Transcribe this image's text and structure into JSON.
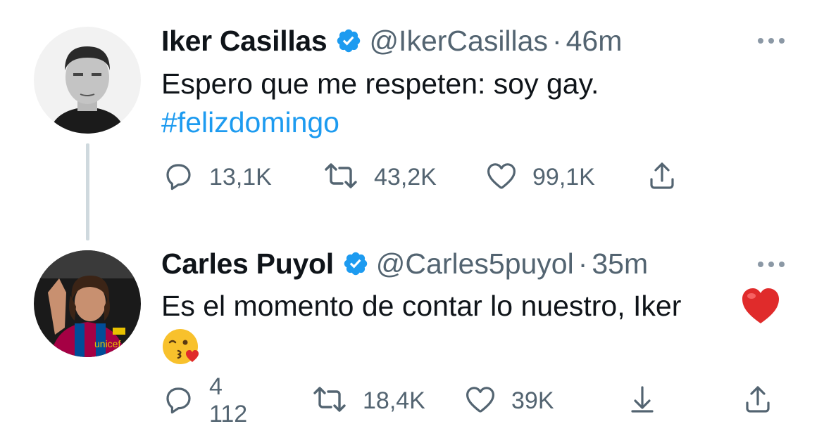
{
  "tweets": [
    {
      "name": "Iker Casillas",
      "handle": "@IkerCasillas",
      "separator": "·",
      "time": "46m",
      "text": "Espero que me respeten: soy gay.",
      "hashtag": "#felizdomingo",
      "replies": "13,1K",
      "retweets": "43,2K",
      "likes": "99,1K",
      "avatar_icon": "avatar-iker-casillas",
      "verified_icon": "verified-badge-icon"
    },
    {
      "name": "Carles Puyol",
      "handle": "@Carles5puyol",
      "separator": "·",
      "time": "35m",
      "text": "Es el momento de contar lo nuestro, Iker",
      "emoji_1": "red-heart-emoji",
      "emoji_2": "face-blowing-kiss-emoji",
      "replies": "4 112",
      "retweets": "18,4K",
      "likes": "39K",
      "avatar_icon": "avatar-carles-puyol",
      "verified_icon": "verified-badge-icon"
    }
  ],
  "colors": {
    "text": "#0f1419",
    "muted": "#536471",
    "link": "#1d9bf0",
    "verified": "#1d9bf0",
    "thread_line": "#cfd9de"
  }
}
